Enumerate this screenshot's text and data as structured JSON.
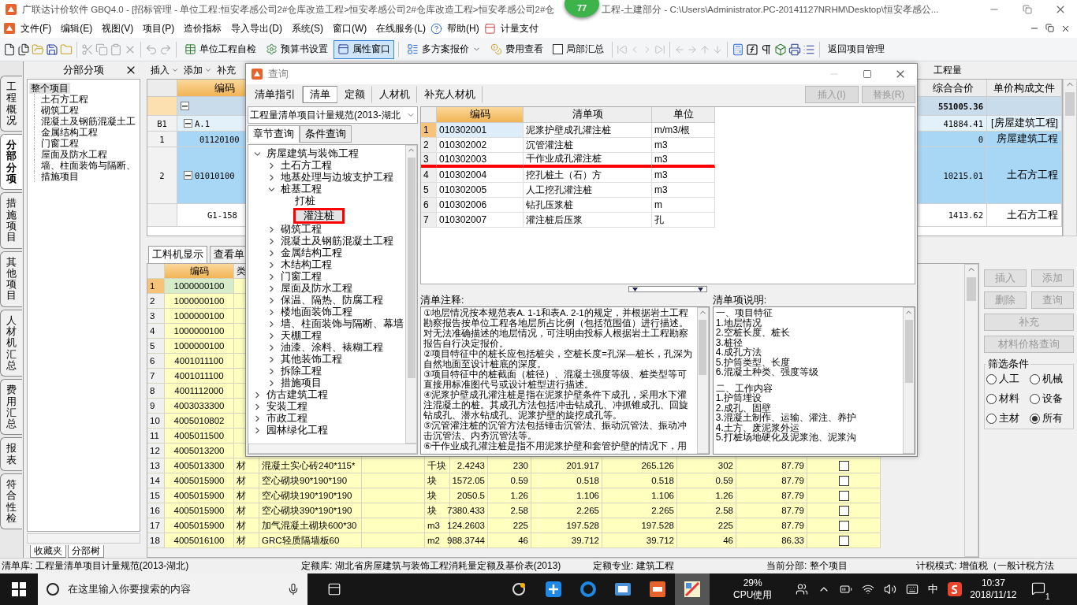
{
  "window": {
    "title_parts": [
      "广联达计价软件 GBQ4.0 - [招标管理 - 单位工程:恒安孝感公司2#仓库改造工程>恒安孝感公司2#仓库改造工程>恒安孝感公司2#仓",
      "工程-土建部分 - C:\\Users\\Administrator.PC-20141127NRHM\\Desktop\\恒安孝感公..."
    ],
    "badge": "77"
  },
  "menu": [
    "文件(F)",
    "编辑(E)",
    "视图(V)",
    "项目(P)",
    "造价指标",
    "导入导出(D)",
    "系统(S)",
    "窗口(W)",
    "在线服务(L)",
    "帮助(H)",
    "计量支付"
  ],
  "toolbar": {
    "self_check": "单位工程自检",
    "budget_settings": "预算书设置",
    "property_window": {
      "label": "属性窗口",
      "selected": true
    },
    "multi_quote": "多方案报价",
    "fee_view": "费用查看",
    "partial_sum": {
      "label": "局部汇总",
      "checked": false
    },
    "back": "返回项目管理"
  },
  "side_tabs": [
    {
      "label": "工程概况",
      "selected": false
    },
    {
      "label": "分部分项",
      "selected": true
    },
    {
      "label": "措施项目",
      "selected": false
    },
    {
      "label": "其他项目",
      "selected": false
    },
    {
      "label": "人材机汇总",
      "selected": false
    },
    {
      "label": "费用汇总",
      "selected": false
    },
    {
      "label": "报表",
      "selected": false
    },
    {
      "label": "符合性检",
      "selected": false
    }
  ],
  "left_panel": {
    "title": "分部分项",
    "tree": {
      "label": "整个项目",
      "selected": true,
      "children": [
        {
          "label": "土石方工程",
          "selected": false
        },
        {
          "label": "砌筑工程",
          "selected": false
        },
        {
          "label": "混凝土及钢筋混凝土工",
          "selected": false
        },
        {
          "label": "金属结构工程",
          "selected": false
        },
        {
          "label": "门窗工程",
          "selected": false
        },
        {
          "label": "屋面及防水工程",
          "selected": false
        },
        {
          "label": "墙、柱面装饰与隔断、",
          "selected": false
        },
        {
          "label": "措施项目",
          "selected": false
        }
      ]
    },
    "bottom_tabs": [
      "收藏夹",
      "分部树"
    ]
  },
  "sub_toolbar": {
    "insert": "插入",
    "add": "添加",
    "supplement": "补充",
    "quantity": "工程量"
  },
  "upper_grid": {
    "columns": {
      "code": "编码",
      "total": "综合合价",
      "file": "单价构成文件"
    },
    "rows": [
      {
        "kind": "root",
        "total": "551005.36",
        "selected": false
      },
      {
        "kind": "section",
        "num": "B1",
        "code": "A.1",
        "total": "41884.41",
        "file": "[房屋建筑工程]",
        "selected": false
      },
      {
        "kind": "item",
        "num": "1",
        "code": "01120100",
        "total": "0",
        "file": "房屋建筑工程",
        "selected": true
      },
      {
        "kind": "group",
        "num": "2",
        "code": "01010100",
        "total": "10215.01",
        "file": "土石方工程",
        "selected": true
      },
      {
        "kind": "sub",
        "code": "G1-158",
        "total": "1413.62",
        "file": "土石方工程",
        "selected": false
      }
    ]
  },
  "lower_tabs": [
    {
      "label": "工料机显示",
      "selected": true
    },
    {
      "label": "查看单",
      "selected": false
    }
  ],
  "lower_grid": {
    "columns": [
      "编码",
      "类"
    ],
    "rows": [
      {
        "num": "1",
        "code": "1000000100",
        "selected": true
      },
      {
        "num": "2",
        "code": "1000000100",
        "selected": false
      },
      {
        "num": "3",
        "code": "1000000100",
        "selected": false
      },
      {
        "num": "4",
        "code": "1000000100",
        "selected": false
      },
      {
        "num": "5",
        "code": "1000000100",
        "selected": false
      },
      {
        "num": "6",
        "code": "4001011100",
        "selected": false
      },
      {
        "num": "7",
        "code": "4001011100",
        "selected": false
      },
      {
        "num": "8",
        "code": "4001112000",
        "selected": false
      },
      {
        "num": "9",
        "code": "4003033300",
        "selected": false
      },
      {
        "num": "10",
        "code": "4005010802",
        "selected": false
      },
      {
        "num": "11",
        "code": "4005011500",
        "selected": false
      },
      {
        "num": "12",
        "code": "4005013200",
        "selected": false
      },
      {
        "num": "13",
        "code": "4005013300",
        "type": "材",
        "name": "混凝土实心砖240*115*",
        "unit": "千块",
        "values": [
          "2.4243",
          "230",
          "201.917",
          "265.126",
          "302",
          "87.79"
        ],
        "checked": false,
        "selected": false
      },
      {
        "num": "14",
        "code": "4005015900",
        "type": "材",
        "name": "空心砌块90*190*190",
        "unit": "块",
        "values": [
          "1572.05",
          "0.59",
          "0.518",
          "0.518",
          "0.59",
          "87.79"
        ],
        "checked": false,
        "selected": false
      },
      {
        "num": "15",
        "code": "4005015900",
        "type": "材",
        "name": "空心砌块190*190*190",
        "unit": "块",
        "values": [
          "2050.5",
          "1.26",
          "1.106",
          "1.106",
          "1.26",
          "87.79"
        ],
        "checked": false,
        "selected": false
      },
      {
        "num": "16",
        "code": "4005015900",
        "type": "材",
        "name": "空心砌块390*190*190",
        "unit": "块",
        "values": [
          "7380.433",
          "2.58",
          "2.265",
          "2.265",
          "2.58",
          "87.79"
        ],
        "checked": false,
        "selected": false
      },
      {
        "num": "17",
        "code": "4005015900",
        "type": "材",
        "name": "加气混凝土砌块600*30",
        "unit": "m3",
        "values": [
          "124.2603",
          "225",
          "197.528",
          "197.528",
          "225",
          "87.79"
        ],
        "checked": false,
        "selected": false
      },
      {
        "num": "18",
        "code": "4005016100",
        "type": "材",
        "name": "GRC轻质隔墙板60",
        "unit": "m2",
        "values": [
          "988.3744",
          "46",
          "39.712",
          "39.712",
          "46",
          "86.33"
        ],
        "checked": false,
        "selected": false
      }
    ]
  },
  "right_panel": {
    "buttons": [
      {
        "label": "插入",
        "disabled": true
      },
      {
        "label": "添加",
        "disabled": true
      },
      {
        "label": "删除",
        "disabled": true
      },
      {
        "label": "查询",
        "disabled": true
      },
      {
        "label": "补充",
        "disabled": true
      },
      {
        "label": "材料价格查询",
        "disabled": true
      }
    ],
    "filter": {
      "title": "筛选条件",
      "options": [
        {
          "label": "人工",
          "selected": false
        },
        {
          "label": "机械",
          "selected": false
        },
        {
          "label": "材料",
          "selected": false
        },
        {
          "label": "设备",
          "selected": false
        },
        {
          "label": "主材",
          "selected": false
        },
        {
          "label": "所有",
          "selected": true
        }
      ]
    }
  },
  "dialog": {
    "title": "查询",
    "tabs": [
      {
        "label": "清单指引",
        "selected": false
      },
      {
        "label": "清单",
        "selected": true
      },
      {
        "label": "定额",
        "selected": false
      },
      {
        "label": "人材机",
        "selected": false
      },
      {
        "label": "补充人材机",
        "selected": false
      }
    ],
    "actions": [
      {
        "label": "插入(I)",
        "disabled": true
      },
      {
        "label": "替换(R)",
        "disabled": true
      }
    ],
    "library": "工程量清单项目计量规范(2013-湖北",
    "search_tabs": [
      {
        "label": "章节查询",
        "selected": true
      },
      {
        "label": "条件查询",
        "selected": false
      }
    ],
    "tree": [
      {
        "label": "房屋建筑与装饰工程",
        "expanded": true,
        "children": [
          {
            "label": "土石方工程",
            "expanded": false
          },
          {
            "label": "地基处理与边坡支护工程",
            "expanded": false
          },
          {
            "label": "桩基工程",
            "expanded": true,
            "children": [
              {
                "label": "打桩",
                "selected": false,
                "boxed": false
              },
              {
                "label": "灌注桩",
                "selected": true,
                "boxed": true
              }
            ]
          },
          {
            "label": "砌筑工程",
            "expanded": false
          },
          {
            "label": "混凝土及钢筋混凝土工程",
            "expanded": false
          },
          {
            "label": "金属结构工程",
            "expanded": false
          },
          {
            "label": "木结构工程",
            "expanded": false
          },
          {
            "label": "门窗工程",
            "expanded": false
          },
          {
            "label": "屋面及防水工程",
            "expanded": false
          },
          {
            "label": "保温、隔热、防腐工程",
            "expanded": false
          },
          {
            "label": "楼地面装饰工程",
            "expanded": false
          },
          {
            "label": "墙、柱面装饰与隔断、幕墙",
            "expanded": false
          },
          {
            "label": "天棚工程",
            "expanded": false
          },
          {
            "label": "油漆、涂料、裱糊工程",
            "expanded": false
          },
          {
            "label": "其他装饰工程",
            "expanded": false
          },
          {
            "label": "拆除工程",
            "expanded": false
          },
          {
            "label": "措施项目",
            "expanded": false
          }
        ]
      },
      {
        "label": "仿古建筑工程",
        "expanded": false
      },
      {
        "label": "安装工程",
        "expanded": false
      },
      {
        "label": "市政工程",
        "expanded": false
      },
      {
        "label": "园林绿化工程",
        "expanded": false
      }
    ],
    "table": {
      "columns": [
        "编码",
        "清单项",
        "单位"
      ],
      "rows": [
        {
          "num": "1",
          "code": "010302001",
          "name": "泥浆护壁成孔灌注桩",
          "unit": "m/m3/根",
          "selected": true,
          "underlined": false
        },
        {
          "num": "2",
          "code": "010302002",
          "name": "沉管灌注桩",
          "unit": "m3",
          "selected": false,
          "underlined": false
        },
        {
          "num": "3",
          "code": "010302003",
          "name": "干作业成孔灌注桩",
          "unit": "m3",
          "selected": false,
          "underlined": true
        },
        {
          "num": "4",
          "code": "010302004",
          "name": "挖孔桩土（石）方",
          "unit": "m3",
          "selected": false,
          "underlined": false
        },
        {
          "num": "5",
          "code": "010302005",
          "name": "人工挖孔灌注桩",
          "unit": "m3",
          "selected": false,
          "underlined": false
        },
        {
          "num": "6",
          "code": "010302006",
          "name": "钻孔压浆桩",
          "unit": "m",
          "selected": false,
          "underlined": false
        },
        {
          "num": "7",
          "code": "010302007",
          "name": "灌注桩后压浆",
          "unit": "孔",
          "selected": false,
          "underlined": false
        }
      ]
    },
    "notes": {
      "label": "清单注释:",
      "paragraphs": [
        "①地层情况按本规范表A. 1-1和表A. 2-1的规定，并根据岩土工程勘察报告按单位工程各地层所占比例（包括范围值）进行描述。对无法准确描述的地层情况，可注明由投标人根据岩土工程勘察报告自行决定报价。",
        "②项目特征中的桩长应包括桩尖，空桩长度=孔深—桩长，孔深为自然地面至设计桩底的深度。",
        "③项目特征中的桩截面（桩径）、混凝土强度等级、桩类型等可直接用标准图代号或设计桩型进行描述。",
        "④泥浆护壁成孔灌注桩是指在泥浆护壁条件下成孔，采用水下灌注混凝土的桩。其成孔方法包括冲击钻成孔、冲抓锥成孔、回旋钻成孔、潜水钻成孔、泥浆护壁的旋挖成孔等。",
        "⑤沉管灌注桩的沉管方法包括锤击沉管法、振动沉管法、振动冲击沉管法、内夯沉管法等。",
        "⑥干作业成孔灌注桩是指不用泥浆护壁和套管护壁的情况下，用"
      ]
    },
    "description": {
      "label": "清单项说明:",
      "sections": [
        [
          "一、项目特征",
          "1.地层情况",
          "2.空桩长度、桩长",
          "3.桩径",
          "4.成孔方法",
          "5.护筒类型、长度",
          "6.混凝土种类、强度等级"
        ],
        [
          "二、工作内容",
          "1.护筒埋设",
          "2.成孔、固壁",
          "3.混凝土制作、运输、灌注、养护",
          "4.土方、废泥浆外运",
          "5.打桩场地硬化及泥浆池、泥浆沟"
        ]
      ]
    }
  },
  "status_bar": [
    "清单库: 工程量清单项目计量规范(2013-湖北)",
    "定额库: 湖北省房屋建筑与装饰工程消耗量定额及基价表(2013)",
    "定额专业: 建筑工程",
    "当前分部: 整个项目",
    "计税模式: 增值税（一般计税方法"
  ],
  "taskbar": {
    "search_placeholder": "在这里输入你要搜索的内容",
    "cpu": "29%",
    "cpu_label": "CPU使用",
    "ime": "中",
    "time": "10:37",
    "date": "2018/11/12",
    "notifications": "1"
  }
}
